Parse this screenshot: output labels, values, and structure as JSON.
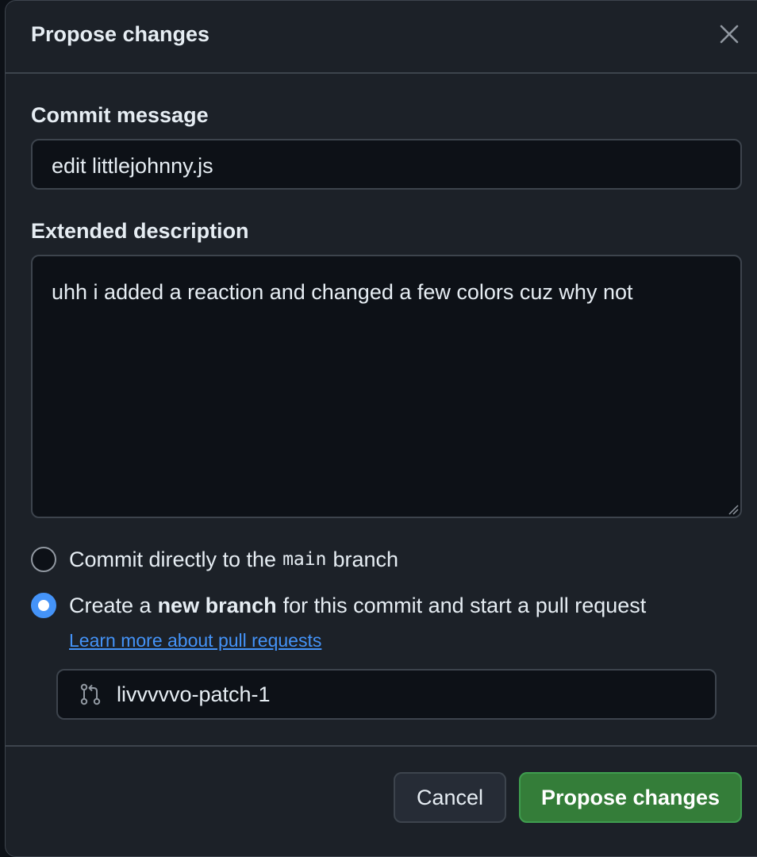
{
  "dialog": {
    "title": "Propose changes",
    "close_icon": "close-icon"
  },
  "commit": {
    "label": "Commit message",
    "value": "edit littlejohnny.js"
  },
  "description": {
    "label": "Extended description",
    "value": "uhh i added a reaction and changed a few colors cuz why not"
  },
  "options": {
    "direct": {
      "prefix": "Commit directly to the",
      "branch": "main",
      "suffix": "branch",
      "selected": false
    },
    "new_branch": {
      "prefix": "Create a",
      "bold": "new branch",
      "suffix": "for this commit and start a pull request",
      "selected": true
    },
    "learn_more": "Learn more about pull requests"
  },
  "branch": {
    "icon": "git-pull-request-icon",
    "value": "livvvvvo-patch-1"
  },
  "buttons": {
    "cancel": "Cancel",
    "propose": "Propose changes"
  },
  "colors": {
    "background": "#1c2128",
    "input_bg": "#0d1117",
    "border": "#3d444d",
    "accent": "#4493f8",
    "primary_button": "#347d39"
  }
}
